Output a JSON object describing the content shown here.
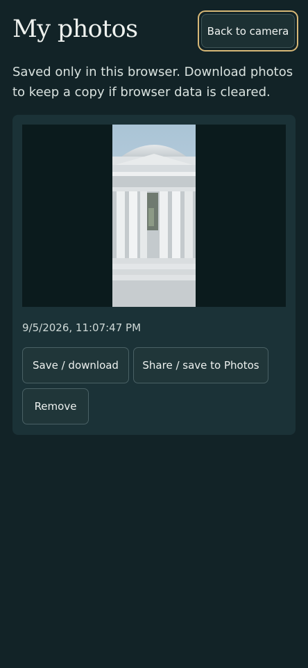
{
  "page": {
    "title": "My photos",
    "intro": "Saved only in this browser. Download photos to keep a copy if browser data is cleared."
  },
  "header": {
    "back_label": "Back to camera"
  },
  "photos": [
    {
      "timestamp": "9/5/2026, 11:07:47 PM",
      "save_label": "Save / download",
      "share_label": "Share / save to Photos",
      "remove_label": "Remove"
    }
  ],
  "colors": {
    "background": "#122327",
    "card": "#1b3237",
    "accent_focus_ring": "#d7b877"
  }
}
